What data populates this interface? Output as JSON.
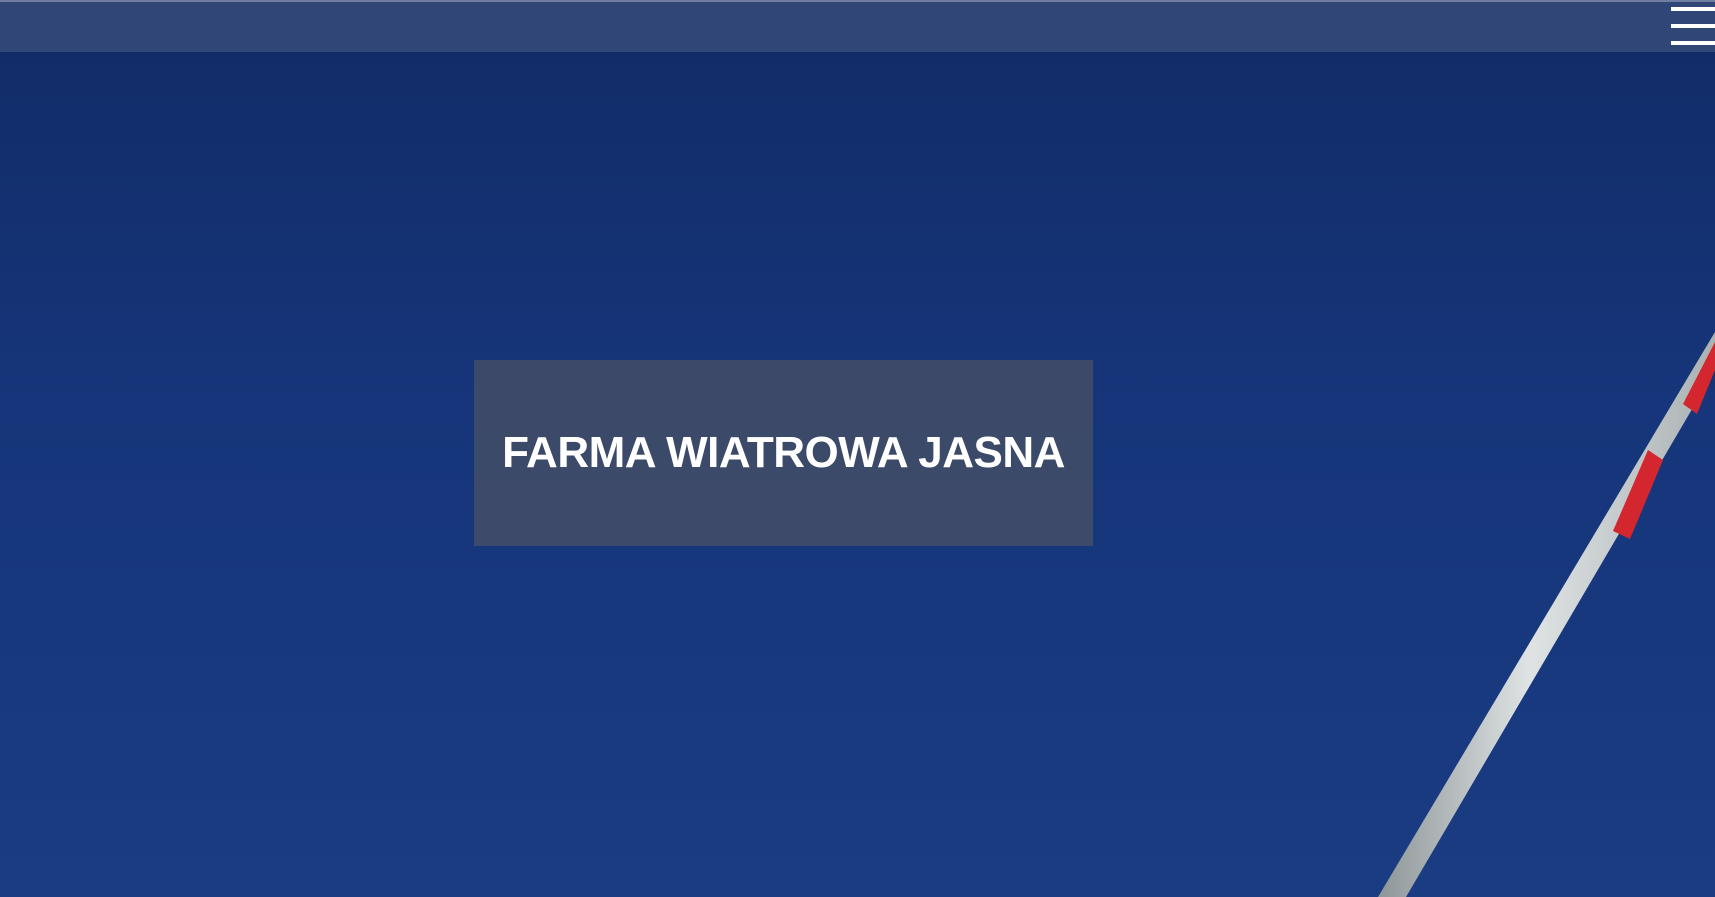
{
  "header": {
    "menu_icon": "hamburger-menu-icon",
    "background_color": "#2f4677"
  },
  "hero": {
    "title": "FARMA WIATROWA JASNA",
    "sky_color": "#16357a",
    "image_subject": "wind turbine blade against blue sky",
    "blade_stripe_color": "#d3262f"
  }
}
